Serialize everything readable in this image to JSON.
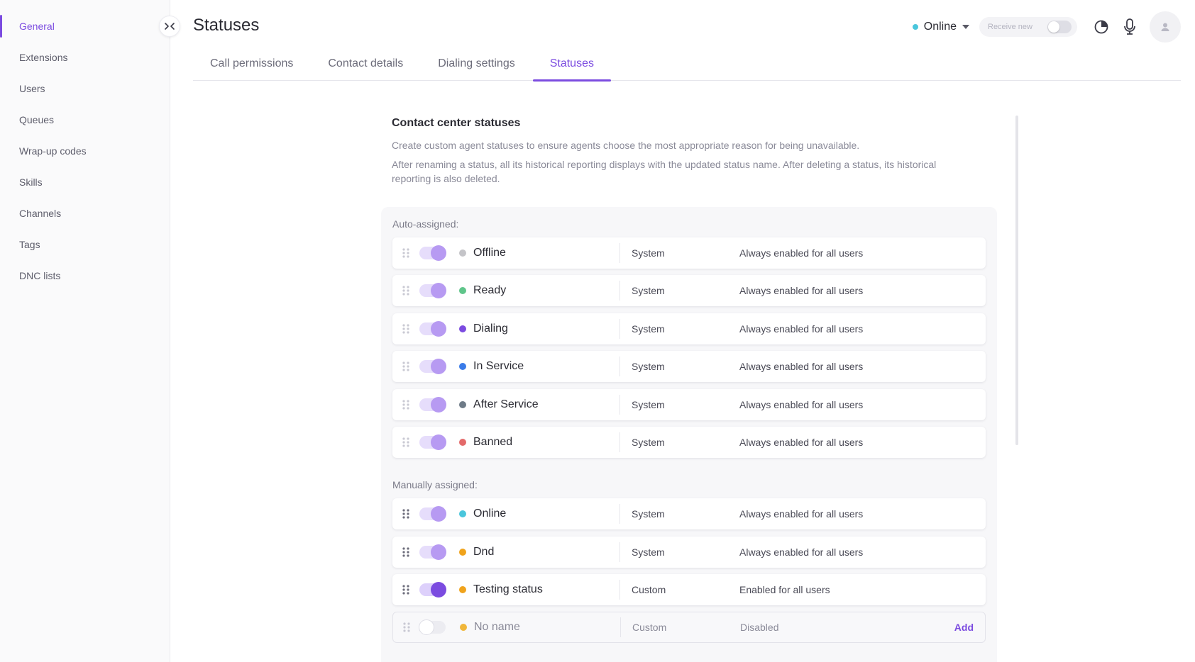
{
  "sidebar": {
    "items": [
      {
        "label": "General",
        "active": true
      },
      {
        "label": "Extensions"
      },
      {
        "label": "Users"
      },
      {
        "label": "Queues"
      },
      {
        "label": "Wrap-up codes"
      },
      {
        "label": "Skills"
      },
      {
        "label": "Channels"
      },
      {
        "label": "Tags"
      },
      {
        "label": "DNC lists"
      }
    ]
  },
  "header": {
    "title": "Statuses",
    "status": {
      "label": "Online",
      "color": "#4ac6dc"
    },
    "receive_label": "Receive new",
    "icons": [
      "collapse-icon",
      "chart-icon",
      "microphone-icon",
      "user-icon",
      "caret-down-icon"
    ]
  },
  "tabs": [
    {
      "label": "Call permissions"
    },
    {
      "label": "Contact details"
    },
    {
      "label": "Dialing settings"
    },
    {
      "label": "Statuses",
      "active": true
    }
  ],
  "section": {
    "title": "Contact center statuses",
    "description1": "Create custom agent statuses to ensure agents choose the most appropriate reason for being unavailable.",
    "description2": "After renaming a status, all its historical reporting displays with the updated status name. After deleting a status, its historical reporting is also deleted."
  },
  "groups": {
    "auto_label": "Auto-assigned:",
    "manual_label": "Manually assigned:"
  },
  "auto_statuses": [
    {
      "name": "Offline",
      "color": "#c4c4c8",
      "type": "System",
      "availability": "Always enabled for all users"
    },
    {
      "name": "Ready",
      "color": "#5fc58a",
      "type": "System",
      "availability": "Always enabled for all users"
    },
    {
      "name": "Dialing",
      "color": "#7b4be0",
      "type": "System",
      "availability": "Always enabled for all users"
    },
    {
      "name": "In Service",
      "color": "#3a7be8",
      "type": "System",
      "availability": "Always enabled for all users"
    },
    {
      "name": "After Service",
      "color": "#6e7b87",
      "type": "System",
      "availability": "Always enabled for all users"
    },
    {
      "name": "Banned",
      "color": "#e36a6a",
      "type": "System",
      "availability": "Always enabled for all users"
    }
  ],
  "manual_statuses": [
    {
      "name": "Online",
      "color": "#4ac6dc",
      "type": "System",
      "availability": "Always enabled for all users"
    },
    {
      "name": "Dnd",
      "color": "#f0a31c",
      "type": "System",
      "availability": "Always enabled for all users"
    },
    {
      "name": "Testing status",
      "color": "#f0a31c",
      "type": "Custom",
      "availability": "Enabled for all users"
    }
  ],
  "new_status": {
    "name": "No name",
    "color": "#f0b63a",
    "type": "Custom",
    "availability": "Disabled",
    "add_label": "Add"
  }
}
